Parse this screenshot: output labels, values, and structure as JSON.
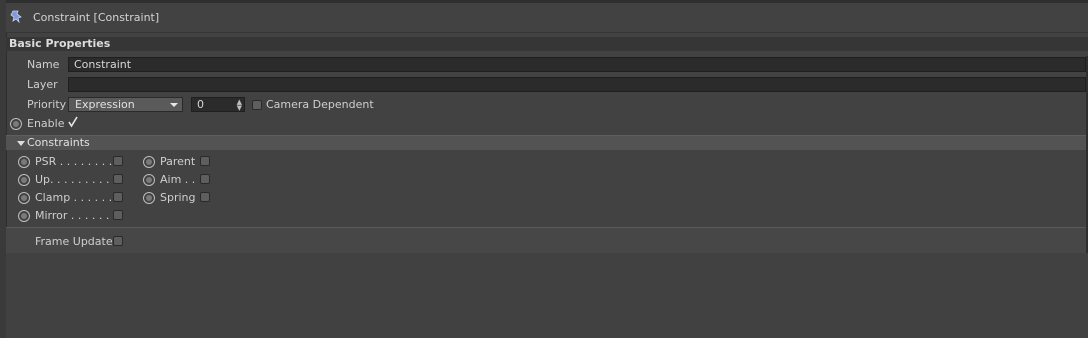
{
  "title": "Constraint [Constraint]",
  "section": "Basic Properties",
  "fields": {
    "name_label": "Name",
    "name_value": "Constraint",
    "layer_label": "Layer",
    "layer_value": "",
    "priority_label": "Priority",
    "priority_selected": "Expression",
    "priority_number": "0",
    "camera_dependent_label": "Camera Dependent",
    "camera_dependent_checked": false,
    "enable_label": "Enable",
    "enable_checked": true
  },
  "constraints_group": {
    "label": "Constraints",
    "expanded": true,
    "left_items": [
      {
        "label": "PSR . . . . . . . . .",
        "checked": false
      },
      {
        "label": "Up. . . . . . . . . .",
        "checked": false
      },
      {
        "label": "Clamp . . . . . . .",
        "checked": false
      },
      {
        "label": "Mirror . . . . . . .",
        "checked": false
      }
    ],
    "right_items": [
      {
        "label": "Parent",
        "checked": false
      },
      {
        "label": "Aim . .",
        "checked": false
      },
      {
        "label": "Spring",
        "checked": false
      }
    ]
  },
  "frame_update": {
    "label": "Frame Update",
    "checked": false
  },
  "icons": {
    "title": "pin-icon",
    "dropdown": "chevron-down-icon",
    "spinner": "spinner-arrows-icon",
    "group_toggle": "triangle-down-icon",
    "enable_check": "checkmark-icon"
  },
  "colors": {
    "background": "#424242",
    "section_bar": "#363636",
    "field": "#2b2b2b",
    "dropdown": "#5a5a5a",
    "group_bar": "#535353",
    "text": "#cfcfcf",
    "title_icon": "#7f9ad8"
  }
}
